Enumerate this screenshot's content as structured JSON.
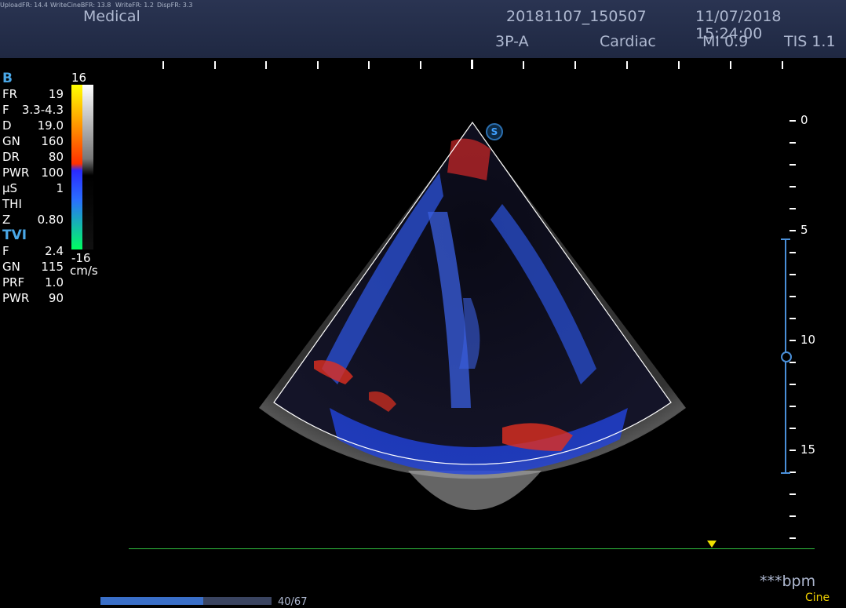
{
  "status_bar": {
    "upload_fr": "UploadFR: 14.4",
    "write_cine_bfr": "WriteCineBFR: 13.8",
    "write_fr": "WriteFR: 1.2",
    "disp_fr": "DispFR: 3.3"
  },
  "header": {
    "title": "Medical",
    "study_id": "20181107_150507",
    "datetime": "11/07/2018 15:24:00",
    "probe": "3P-A",
    "preset": "Cardiac",
    "mi": "MI 0.9",
    "tis": "TIS 1.1"
  },
  "b_mode": {
    "label": "B",
    "params": [
      {
        "k": "FR",
        "v": "19"
      },
      {
        "k": "F",
        "v": "3.3-4.3"
      },
      {
        "k": "D",
        "v": "19.0"
      },
      {
        "k": "GN",
        "v": "160"
      },
      {
        "k": "DR",
        "v": "80"
      },
      {
        "k": "PWR",
        "v": "100"
      },
      {
        "k": "μS",
        "v": "1"
      },
      {
        "k": "THI",
        "v": ""
      },
      {
        "k": "Z",
        "v": "0.80"
      }
    ]
  },
  "tvi_mode": {
    "label": "TVI",
    "params": [
      {
        "k": "F",
        "v": "2.4"
      },
      {
        "k": "GN",
        "v": "115"
      },
      {
        "k": "PRF",
        "v": "1.0"
      },
      {
        "k": "PWR",
        "v": "90"
      }
    ]
  },
  "color_scale": {
    "max": "16",
    "min": "-16",
    "unit": "cm/s"
  },
  "depth_scale": {
    "labels": [
      "0",
      "5",
      "10",
      "15"
    ]
  },
  "image_badge": "S",
  "heart_rate": "***bpm",
  "cine": {
    "label": "Cine",
    "frame": "40/67",
    "progress": 0.6
  },
  "colors": {
    "header_bg": "#252e4a",
    "header_text": "#aeb8d0",
    "accent": "#4aa8e8",
    "ecg_line": "#30c040",
    "marker": "#f0e000"
  }
}
